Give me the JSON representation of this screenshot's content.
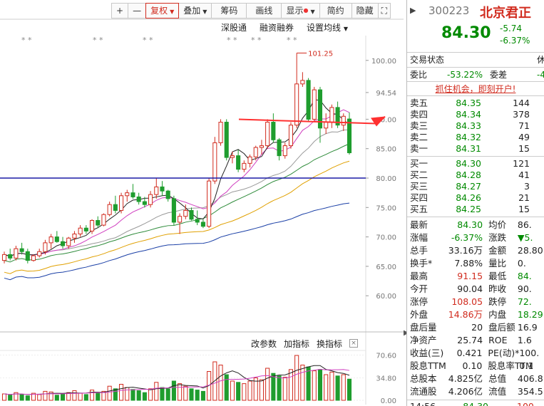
{
  "toolbar": {
    "plus": "+",
    "minus": "—",
    "fuquan": "复权",
    "diejia": "叠加",
    "chouma": "筹码",
    "huaxian": "画线",
    "xianshi": "显示",
    "jianyue": "简约",
    "yincang": "隐藏",
    "expand": "⛶"
  },
  "chart_header": {
    "shengutong": "深股通",
    "rongzi": "融资融券",
    "shezhi": "设置均线"
  },
  "chart_data": {
    "type": "candlestick",
    "price_axis": {
      "ticks": [
        "100.00",
        "94.54",
        "90.00",
        "85.00",
        "80.00",
        "75.00",
        "70.00",
        "65.00",
        "60.00"
      ],
      "ylim": [
        57,
        103
      ]
    },
    "volume_axis": {
      "ticks": [
        "70.60",
        "34.80",
        "0.00"
      ],
      "ylim": [
        0,
        80
      ]
    },
    "annotations": {
      "high_label": "101.25",
      "stars": "* *"
    },
    "candles": [
      [
        66,
        67.5,
        65.5,
        67
      ],
      [
        67,
        68,
        66,
        66.4
      ],
      [
        66.4,
        68.5,
        66,
        68
      ],
      [
        68,
        69,
        67,
        67.5
      ],
      [
        67.5,
        68,
        65.5,
        66
      ],
      [
        66,
        67,
        65.8,
        66.8
      ],
      [
        66.8,
        68,
        66.5,
        67.5
      ],
      [
        67.5,
        69.5,
        67,
        69
      ],
      [
        69,
        70.5,
        68,
        70
      ],
      [
        70,
        71,
        69,
        69.2
      ],
      [
        69.2,
        70,
        68,
        68.5
      ],
      [
        68.5,
        70,
        68,
        69.8
      ],
      [
        69.8,
        71,
        69,
        70.5
      ],
      [
        70.5,
        72,
        70,
        71.5
      ],
      [
        71.5,
        72,
        70.5,
        71
      ],
      [
        71,
        73,
        70.5,
        72.8
      ],
      [
        72.8,
        73.5,
        71.5,
        72
      ],
      [
        72,
        74,
        71.8,
        73.8
      ],
      [
        73.8,
        76,
        73.5,
        75.5
      ],
      [
        75.5,
        77,
        74,
        74.5
      ],
      [
        74.5,
        77.5,
        74,
        77
      ],
      [
        77,
        78,
        76,
        77.5
      ],
      [
        77.5,
        79,
        76.5,
        76.8
      ],
      [
        76.8,
        77.5,
        75.5,
        76
      ],
      [
        76,
        76.8,
        75,
        75.5
      ],
      [
        75.5,
        77.8,
        75,
        77.2
      ],
      [
        77.2,
        80,
        76.5,
        78.5
      ],
      [
        78.5,
        79.5,
        77,
        77.8
      ],
      [
        77.8,
        78,
        76,
        76.5
      ],
      [
        76.5,
        77,
        72,
        72.5
      ],
      [
        72.5,
        74,
        70.5,
        73.5
      ],
      [
        73.5,
        75.5,
        73,
        74.5
      ],
      [
        74.5,
        75,
        72.8,
        73
      ],
      [
        73,
        74.5,
        72,
        72.5
      ],
      [
        72.5,
        73,
        71.5,
        71.8
      ],
      [
        71.8,
        80,
        71.5,
        79.5
      ],
      [
        79.5,
        87,
        79,
        86
      ],
      [
        86,
        90,
        85.5,
        89.5
      ],
      [
        89.5,
        90,
        83,
        83.5
      ],
      [
        83.5,
        84.5,
        82.5,
        83.8
      ],
      [
        83.8,
        84.8,
        81,
        81.5
      ],
      [
        81.5,
        83,
        81,
        82.5
      ],
      [
        82.5,
        84,
        81.8,
        83.6
      ],
      [
        83.6,
        85.5,
        83,
        85.2
      ],
      [
        85.2,
        86.5,
        84,
        85.5
      ],
      [
        85.5,
        90,
        85,
        89.5
      ],
      [
        89.5,
        91,
        86,
        86.5
      ],
      [
        86.5,
        86.8,
        83,
        83.8
      ],
      [
        83.8,
        86,
        83.3,
        85.5
      ],
      [
        85.5,
        89.5,
        85,
        89
      ],
      [
        89,
        101.25,
        88.5,
        96
      ],
      [
        96,
        98,
        95.5,
        96.6
      ],
      [
        96.6,
        97,
        89.5,
        90
      ],
      [
        90,
        95.5,
        89.5,
        95
      ],
      [
        95,
        95.5,
        86,
        88.5
      ],
      [
        88.5,
        91,
        87.5,
        89.5
      ],
      [
        89.5,
        92.5,
        88.5,
        92
      ],
      [
        92,
        93,
        88.5,
        89
      ],
      [
        89,
        91,
        88,
        90.5
      ],
      [
        90.04,
        91.15,
        84,
        84.3
      ]
    ],
    "volumes": [
      10,
      8,
      12,
      9,
      7,
      11,
      9,
      14,
      13,
      8,
      10,
      12,
      15,
      11,
      9,
      16,
      12,
      14,
      22,
      18,
      25,
      20,
      17,
      15,
      12,
      18,
      28,
      20,
      18,
      30,
      26,
      22,
      18,
      16,
      14,
      45,
      60,
      55,
      40,
      30,
      28,
      26,
      30,
      35,
      32,
      50,
      42,
      38,
      36,
      48,
      70,
      55,
      52,
      46,
      48,
      40,
      44,
      38,
      40,
      33
    ],
    "ma_lines": [
      "MA5",
      "MA10",
      "MA20",
      "MA30",
      "MA60",
      "MA120"
    ],
    "support_line": 80.0,
    "arrow_target_price": 89.5
  },
  "volume_menu": {
    "params": "改参数",
    "add": "加指标",
    "switch": "换指标",
    "close": "×"
  },
  "quote": {
    "code": "300223",
    "name": "北京君正",
    "price": "84.30",
    "chg_abs": "-5.74",
    "chg_pct": "-6.37%",
    "status_label": "交易状态",
    "status_value": "休",
    "weibi_label": "委比",
    "weibi_value": "-53.22%",
    "weicha_label": "委差",
    "weicha_value": "-4",
    "promo": "抓住机会，即刻开户!"
  },
  "asks": [
    {
      "label": "卖五",
      "price": "84.35",
      "vol": "144"
    },
    {
      "label": "卖四",
      "price": "84.34",
      "vol": "378"
    },
    {
      "label": "卖三",
      "price": "84.33",
      "vol": "71"
    },
    {
      "label": "卖二",
      "price": "84.32",
      "vol": "49"
    },
    {
      "label": "卖一",
      "price": "84.31",
      "vol": "15"
    }
  ],
  "bids": [
    {
      "label": "买一",
      "price": "84.30",
      "vol": "121"
    },
    {
      "label": "买二",
      "price": "84.28",
      "vol": "41"
    },
    {
      "label": "买三",
      "price": "84.27",
      "vol": "3"
    },
    {
      "label": "买四",
      "price": "84.26",
      "vol": "21"
    },
    {
      "label": "买五",
      "price": "84.25",
      "vol": "15"
    }
  ],
  "stats": [
    {
      "l1": "最新",
      "v1": "84.30",
      "c1": "green",
      "l2": "均价",
      "v2": "86.",
      "c2": "blk"
    },
    {
      "l1": "涨幅",
      "v1": "-6.37%",
      "c1": "green",
      "l2": "涨跌",
      "v2": "▼5.",
      "c2": "green"
    },
    {
      "l1": "总手",
      "v1": "33.16万",
      "c1": "blk",
      "l2": "金额",
      "v2": "28.80",
      "c2": "blk"
    },
    {
      "l1": "换手*",
      "v1": "7.88%",
      "c1": "blk",
      "l2": "量比",
      "v2": "0.",
      "c2": "blk"
    },
    {
      "l1": "最高",
      "v1": "91.15",
      "c1": "red",
      "l2": "最低",
      "v2": "84.",
      "c2": "green"
    },
    {
      "l1": "今开",
      "v1": "90.04",
      "c1": "blk",
      "l2": "昨收",
      "v2": "90.",
      "c2": "blk"
    },
    {
      "l1": "涨停",
      "v1": "108.05",
      "c1": "red",
      "l2": "跌停",
      "v2": "72.",
      "c2": "green"
    },
    {
      "l1": "外盘",
      "v1": "14.86万",
      "c1": "red",
      "l2": "内盘",
      "v2": "18.29",
      "c2": "green"
    },
    {
      "l1": "盘后量",
      "v1": "20",
      "c1": "blk",
      "l2": "盘后额",
      "v2": "16.9",
      "c2": "blk"
    },
    {
      "l1": "净资产",
      "v1": "25.74",
      "c1": "blk",
      "l2": "ROE",
      "v2": "1.6",
      "c2": "blk"
    },
    {
      "l1": "收益(三)",
      "v1": "0.421",
      "c1": "blk",
      "l2": "PE(动)*",
      "v2": "100.",
      "c2": "blk"
    },
    {
      "l1": "股息TTM",
      "v1": "0.10",
      "c1": "blk",
      "l2": "股息率TTM",
      "v2": "0.1",
      "c2": "blk"
    },
    {
      "l1": "总股本",
      "v1": "4.825亿",
      "c1": "blk",
      "l2": "总值",
      "v2": "406.8",
      "c2": "blk"
    },
    {
      "l1": "流通股",
      "v1": "4.206亿",
      "c1": "blk",
      "l2": "流值",
      "v2": "354.5",
      "c2": "blk"
    }
  ],
  "tick_row": {
    "time": "14:56",
    "price": "84.30",
    "vol": "100"
  }
}
